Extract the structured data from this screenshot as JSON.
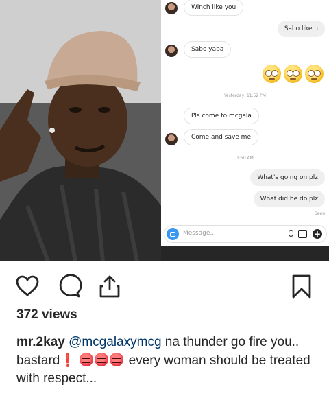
{
  "chat": {
    "messages": [
      {
        "dir": "in",
        "text": "Winch like you"
      },
      {
        "dir": "out",
        "text": "Sabo like u"
      },
      {
        "dir": "in",
        "text": "Sabo yaba"
      },
      {
        "dir": "in",
        "text": "Pls come to mcgala"
      },
      {
        "dir": "in",
        "text": "Come and save me"
      },
      {
        "dir": "out",
        "text": "What's going on plz"
      },
      {
        "dir": "out",
        "text": "What did he do plz"
      }
    ],
    "timestamp_1": "Yesterday, 11:52 PM",
    "timestamp_2": "1:50 AM",
    "seen_label": "Seen",
    "composer_placeholder": "Message..."
  },
  "post": {
    "views": "372 views",
    "username": "mr.2kay",
    "mention": "@mcgalaxymcg",
    "caption_part1": " na thunder go fire you.. bastard",
    "exclamation": "❗",
    "caption_part2": " every woman should be treated with respect..."
  },
  "icons": [
    "heart-icon",
    "comment-icon",
    "share-icon",
    "bookmark-icon",
    "camera-icon",
    "mic-icon",
    "gallery-icon",
    "plus-icon"
  ],
  "colors": {
    "accent": "#3897f0",
    "mention": "#003569",
    "text": "#262626",
    "angry": "#e0283a"
  }
}
